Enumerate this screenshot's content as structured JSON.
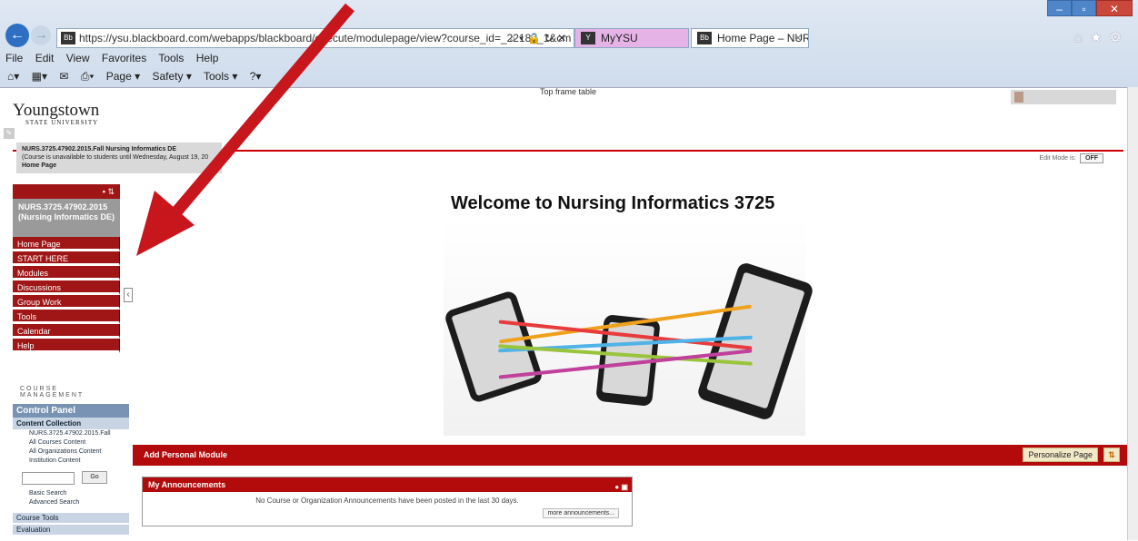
{
  "browser": {
    "url": "https://ysu.blackboard.com/webapps/blackboard/execute/modulepage/view?course_id=_22187_1&cm",
    "tab1_label": "MyYSU",
    "tab2_label": "Home Page – NURS...",
    "menu": [
      "File",
      "Edit",
      "View",
      "Favorites",
      "Tools",
      "Help"
    ],
    "command": [
      "Page ▾",
      "Safety ▾",
      "Tools ▾"
    ]
  },
  "top_frame": {
    "title": "Top frame table",
    "logo": "Youngstown",
    "logo_sub": "STATE UNIVERSITY"
  },
  "breadcrumb": {
    "course": "NURS.3725.47902.2015.Fall Nursing Informatics DE",
    "note": "(Course is unavailable to students until Wednesday, August 19, 20",
    "page": "Home Page"
  },
  "edit_mode": {
    "label": "Edit Mode is:",
    "value": "OFF"
  },
  "course_menu": {
    "course_title": "NURS.3725.47902.2015 (Nursing Informatics DE)",
    "items": [
      "Home Page",
      "START HERE",
      "Modules",
      "Discussions",
      "Group Work",
      "Tools",
      "Calendar",
      "Help"
    ]
  },
  "course_management": {
    "title": "COURSE MANAGEMENT",
    "control_panel": "Control Panel",
    "content_collection": "Content Collection",
    "collection_items": [
      "NURS.3725.47902.2015.Fall",
      "All Courses Content",
      "All Organizations Content",
      "Institution Content"
    ],
    "go": "Go",
    "search_links": [
      "Basic Search",
      "Advanced Search"
    ],
    "course_tools": "Course Tools",
    "evaluation": "Evaluation"
  },
  "main": {
    "welcome": "Welcome to Nursing Informatics 3725",
    "add_module": "Add Personal Module",
    "personalize": "Personalize Page"
  },
  "announcements": {
    "title": "My Announcements",
    "message": "No Course or Organization Announcements have been posted in the last 30 days.",
    "more": "more announcements..."
  },
  "colors": {
    "accent": "#b30b0c",
    "arrow": "#c8161d"
  }
}
